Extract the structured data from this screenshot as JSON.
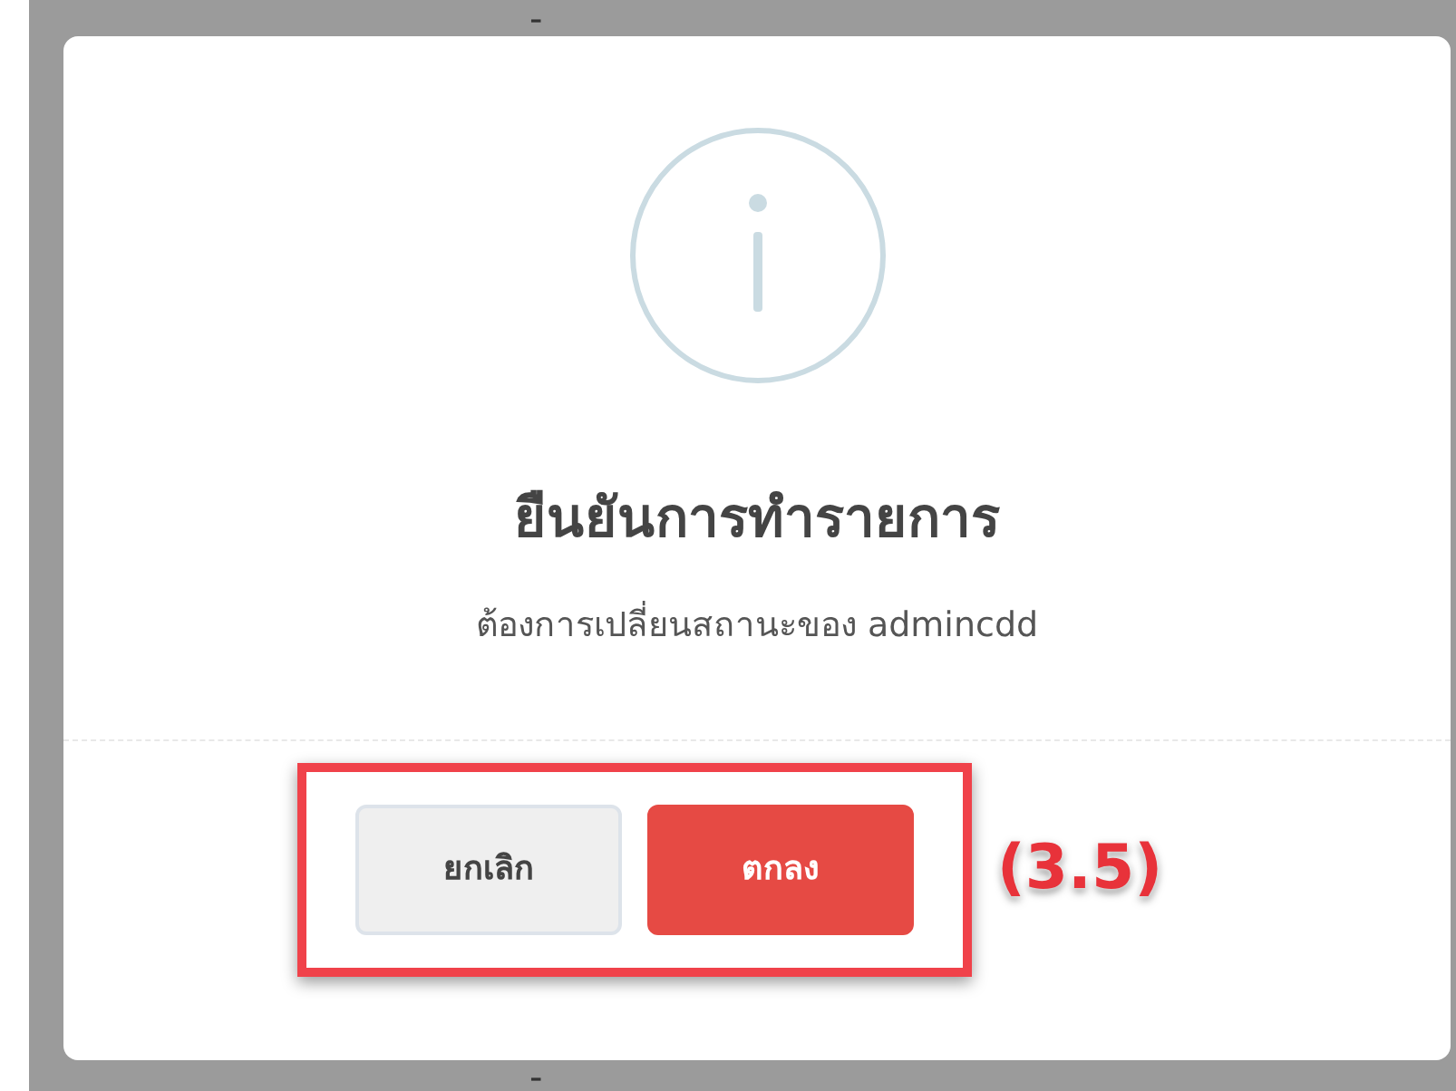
{
  "background_table": {
    "rows": [
      {
        "column_2": "-"
      },
      {
        "column_2": "-"
      }
    ]
  },
  "dialog": {
    "title": "ยืนยันการทำรายการ",
    "message": "ต้องการเปลี่ยนสถานะของ admincdd",
    "buttons": [
      {
        "label": "ยกเลิก",
        "kind": "secondary"
      },
      {
        "label": "ตกลง",
        "kind": "primary"
      }
    ],
    "highlight_label": "(3.5)"
  }
}
